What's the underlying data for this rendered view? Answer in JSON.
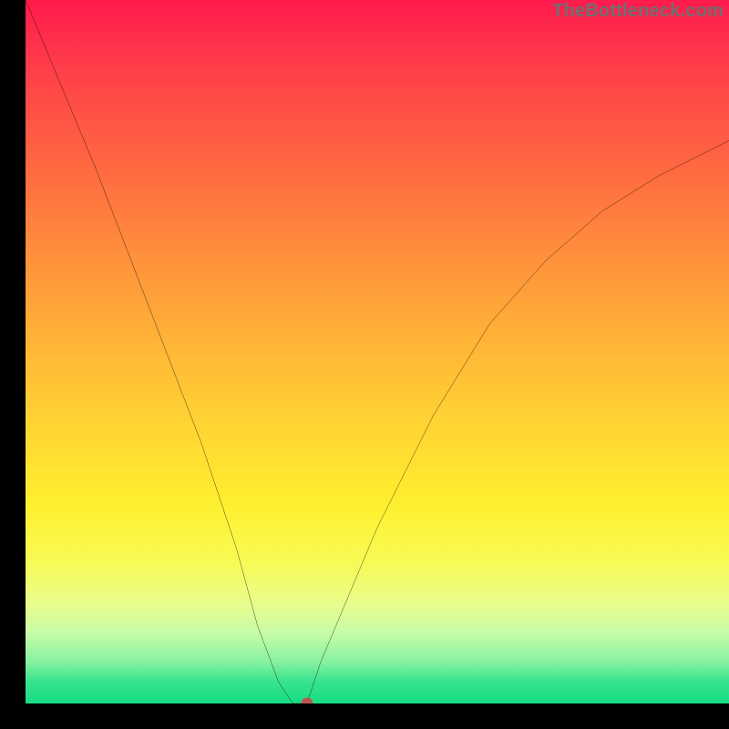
{
  "watermark": "TheBottleneck.com",
  "chart_data": {
    "type": "line",
    "title": "",
    "xlabel": "",
    "ylabel": "",
    "xlim": [
      0,
      100
    ],
    "ylim": [
      0,
      100
    ],
    "annotations": [],
    "grid": false,
    "series": [
      {
        "name": "curve",
        "x": [
          0,
          5,
          10,
          15,
          20,
          25,
          30,
          33,
          36,
          38,
          40,
          42,
          50,
          58,
          66,
          74,
          82,
          90,
          100
        ],
        "y": [
          100,
          88,
          76,
          63,
          50,
          37,
          22,
          11,
          3,
          0,
          0,
          6,
          25,
          41,
          54,
          63,
          70,
          75,
          80
        ]
      }
    ],
    "marker": {
      "x": 40,
      "y": 0
    },
    "gradient_stops": [
      {
        "pct": 0,
        "color": "#ff1a4d"
      },
      {
        "pct": 24,
        "color": "#ff6a41"
      },
      {
        "pct": 48,
        "color": "#ffb237"
      },
      {
        "pct": 72,
        "color": "#fff02f"
      },
      {
        "pct": 90,
        "color": "#c7fca7"
      },
      {
        "pct": 100,
        "color": "#17dd83"
      }
    ]
  }
}
